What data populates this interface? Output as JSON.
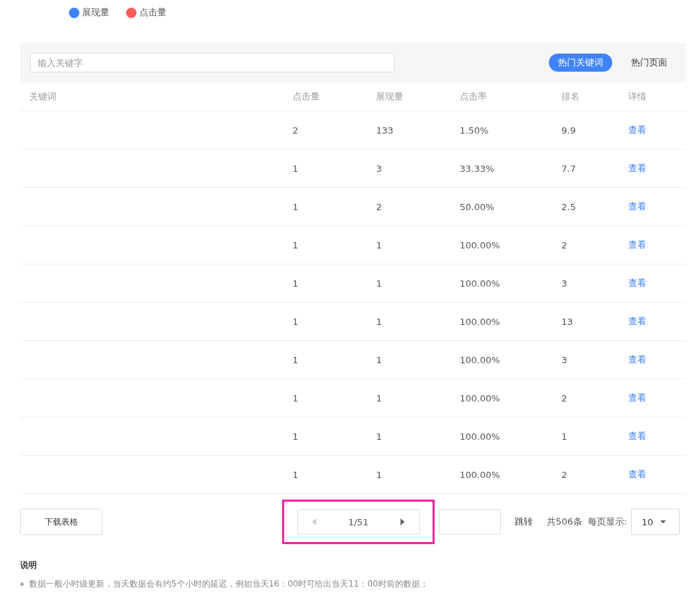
{
  "legend": [
    {
      "label": "展现量",
      "color": "#3f83f8"
    },
    {
      "label": "点击量",
      "color": "#fa5c5c"
    }
  ],
  "search": {
    "placeholder": "输入关键字"
  },
  "tabs": [
    {
      "label": "热门关键词",
      "selected": true
    },
    {
      "label": "热门页面",
      "selected": false
    }
  ],
  "table": {
    "columns": [
      "关键词",
      "点击量",
      "展现量",
      "点击率",
      "排名",
      "详情"
    ],
    "rows": [
      {
        "clicks": "2",
        "impressions": "133",
        "ctr": "1.50%",
        "rank": "9.9",
        "link": "查看"
      },
      {
        "clicks": "1",
        "impressions": "3",
        "ctr": "33.33%",
        "rank": "7.7",
        "link": "查看"
      },
      {
        "clicks": "1",
        "impressions": "2",
        "ctr": "50.00%",
        "rank": "2.5",
        "link": "查看"
      },
      {
        "clicks": "1",
        "impressions": "1",
        "ctr": "100.00%",
        "rank": "2",
        "link": "查看"
      },
      {
        "clicks": "1",
        "impressions": "1",
        "ctr": "100.00%",
        "rank": "3",
        "link": "查看"
      },
      {
        "clicks": "1",
        "impressions": "1",
        "ctr": "100.00%",
        "rank": "13",
        "link": "查看"
      },
      {
        "clicks": "1",
        "impressions": "1",
        "ctr": "100.00%",
        "rank": "3",
        "link": "查看"
      },
      {
        "clicks": "1",
        "impressions": "1",
        "ctr": "100.00%",
        "rank": "2",
        "link": "查看"
      },
      {
        "clicks": "1",
        "impressions": "1",
        "ctr": "100.00%",
        "rank": "1",
        "link": "查看"
      },
      {
        "clicks": "1",
        "impressions": "1",
        "ctr": "100.00%",
        "rank": "2",
        "link": "查看"
      }
    ]
  },
  "footer": {
    "download": "下载表格",
    "pager": {
      "text": "1/51",
      "prev_disabled": true,
      "next_disabled": false
    },
    "jump": "跳转",
    "total": "共506条",
    "per_page_label": "每页显示:",
    "per_page": "10"
  },
  "notes": {
    "title": "说明",
    "items": [
      "数据一般小时级更新，当天数据会有约5个小时的延迟，例如当天16：00时可给出当天11：00时前的数据；"
    ]
  }
}
